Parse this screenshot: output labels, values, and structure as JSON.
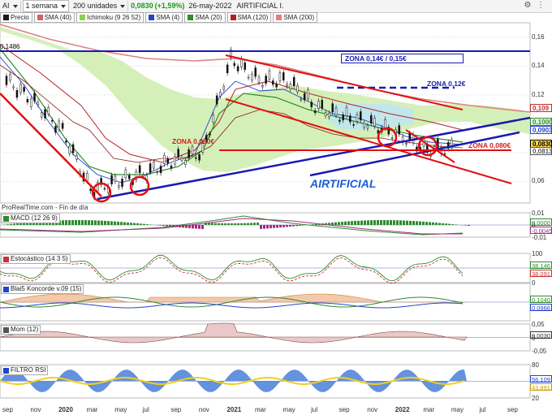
{
  "toolbar": {
    "symbol": "AI",
    "period": "1 semana",
    "units": "200 unidades",
    "price": "0,0830",
    "change": "(+1,59%)",
    "date": "26-may-2022",
    "name": "AIRTIFICIAL I."
  },
  "legend": [
    {
      "label": "Precio",
      "color": "#1a1a1a"
    },
    {
      "label": "SMA (40)",
      "color": "#cc6666"
    },
    {
      "label": "Ichimoku (9 26 52)",
      "color": "#8fd14f"
    },
    {
      "label": "SMA (4)",
      "color": "#2244cc"
    },
    {
      "label": "SMA (20)",
      "color": "#2e8b2e"
    },
    {
      "label": "SMA (120)",
      "color": "#b22222"
    },
    {
      "label": "SMA (200)",
      "color": "#e08080"
    }
  ],
  "annotations": {
    "high_label": "0,1486",
    "zona_014_015": "ZONA 0,14€ / 0,15€",
    "zona_012": "ZONA 0,12€",
    "zona_0080_left": "ZONA 0,080€",
    "zona_0080_right": "ZONA 0,080€",
    "title": "AIRTIFICIAL",
    "source": "ProRealTime.com - Fin de día"
  },
  "price_axis": [
    "0,16",
    "0,14",
    "0,12",
    "0,10",
    "0,08",
    "0,06"
  ],
  "price_tags": [
    {
      "value": "0,109",
      "color": "#c0302a",
      "bg": "#fff"
    },
    {
      "value": "0,1000",
      "color": "#2e8b2e",
      "bg": "#e9f7e0"
    },
    {
      "value": "0,0903",
      "color": "#2244cc",
      "bg": "#fff"
    },
    {
      "value": "0,0830",
      "color": "#000",
      "bg": "#ffd84d"
    },
    {
      "value": "0,0813",
      "color": "#555",
      "bg": "#fff"
    }
  ],
  "panels": [
    {
      "title": "MACD (12 26 9)",
      "ticks": [
        "0,01",
        "0",
        "-0,01"
      ],
      "tags": [
        {
          "value": "0,0000",
          "color": "#2e8b2e"
        },
        {
          "value": "-0,0045",
          "color": "#a52a7f"
        }
      ]
    },
    {
      "title": "Estocástico (14 3 5)",
      "ticks": [
        "100",
        "0"
      ],
      "tags": [
        {
          "value": "38,146",
          "color": "#2e8b2e"
        },
        {
          "value": "38,091",
          "color": "#cc3333"
        }
      ]
    },
    {
      "title": "Blai5 Koncorde v.09 (15)",
      "ticks": [],
      "tags": [
        {
          "value": "0,1040",
          "color": "#2e8b2e"
        },
        {
          "value": "0,0966",
          "color": "#2244cc"
        }
      ]
    },
    {
      "title": "Mom (12)",
      "ticks": [
        "0,05",
        "0",
        "-0,05"
      ],
      "tags": [
        {
          "value": "0,0030",
          "color": "#333"
        }
      ]
    },
    {
      "title": "FILTRO RSI",
      "ticks": [
        "80",
        "20"
      ],
      "tags": [
        {
          "value": "56,109",
          "color": "#2244cc"
        },
        {
          "value": "43,891",
          "color": "#cc9900"
        }
      ]
    }
  ],
  "x_axis": [
    "sep",
    "nov",
    "2020",
    "mar",
    "may",
    "jul",
    "sep",
    "nov",
    "2021",
    "mar",
    "may",
    "jul",
    "sep",
    "nov",
    "2022",
    "mar",
    "may",
    "jul",
    "sep"
  ],
  "chart_data": {
    "type": "line",
    "title": "AIRTIFICIAL",
    "xlabel": "",
    "ylabel": "",
    "ylim": [
      0.045,
      0.17
    ],
    "x": [
      "2019-09",
      "2019-11",
      "2020-01",
      "2020-03",
      "2020-05",
      "2020-07",
      "2020-09",
      "2020-11",
      "2021-01",
      "2021-03",
      "2021-05",
      "2021-07",
      "2021-09",
      "2021-11",
      "2022-01",
      "2022-03",
      "2022-05"
    ],
    "series": [
      {
        "name": "Precio",
        "values": [
          0.13,
          0.115,
          0.095,
          0.054,
          0.06,
          0.066,
          0.075,
          0.08,
          0.145,
          0.13,
          0.13,
          0.112,
          0.105,
          0.1,
          0.092,
          0.082,
          0.083
        ]
      }
    ],
    "levels": [
      0.0804,
      0.12,
      0.14,
      0.15
    ],
    "grid": true
  }
}
